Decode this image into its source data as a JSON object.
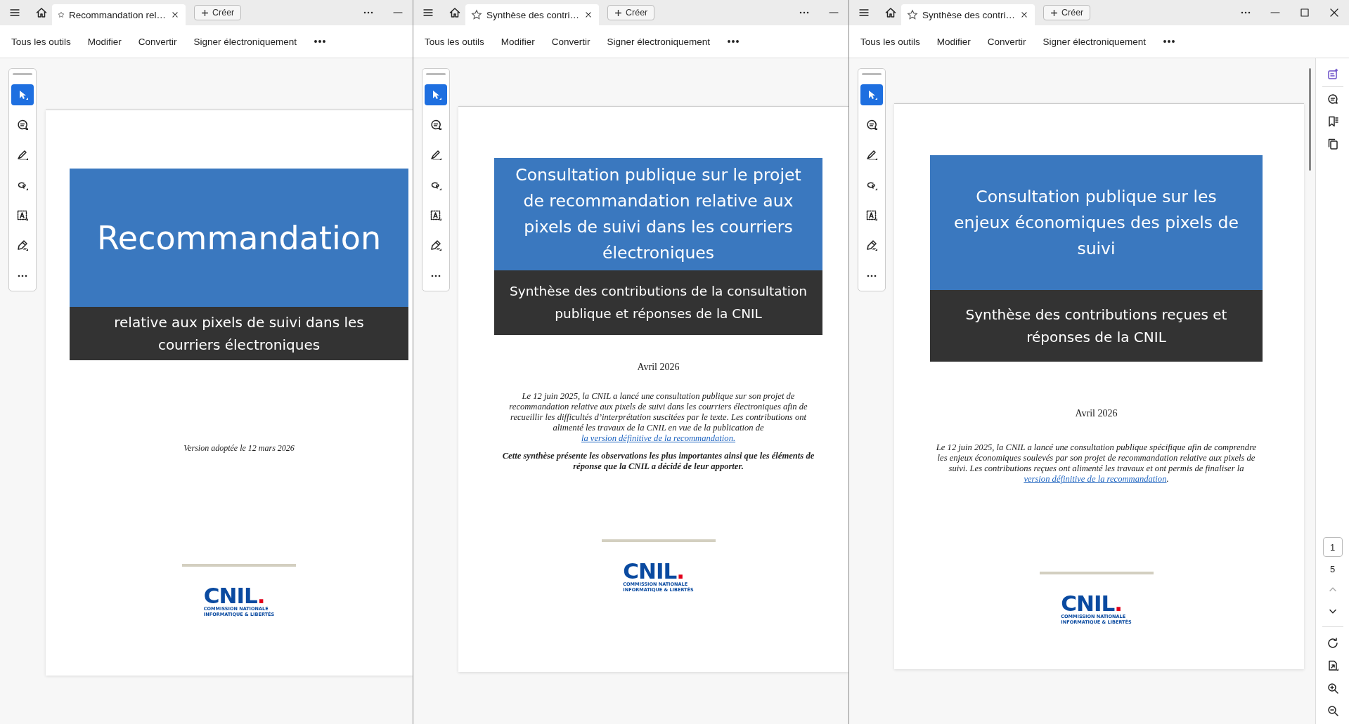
{
  "panes": [
    {
      "tab": {
        "title": "Recommandation rel…",
        "starred": false
      },
      "new_button": "Créer",
      "window_controls": [
        {
          "kind": "more"
        },
        {
          "kind": "minimize"
        }
      ],
      "menu": [
        "Tous les outils",
        "Modifier",
        "Convertir",
        "Signer électroniquement"
      ],
      "tools": [
        {
          "kind": "select",
          "selected": true
        },
        {
          "kind": "comment",
          "selected": false
        },
        {
          "kind": "highlight",
          "selected": false
        },
        {
          "kind": "draw",
          "selected": false
        },
        {
          "kind": "text",
          "selected": false
        },
        {
          "kind": "sign",
          "selected": false
        },
        {
          "kind": "more",
          "selected": false
        }
      ],
      "document": {
        "kind": "recommendation",
        "title": "Recommandation",
        "subtitle": "relative aux pixels de suivi dans les courriers électroniques",
        "version": "Version adoptée le 12 mars 2026",
        "logo": {
          "name": "CNIL",
          "dot": ".",
          "line_1": "COMMISSION NATIONALE",
          "line_2": "INFORMATIQUE & LIBERTÉS"
        }
      }
    },
    {
      "tab": {
        "title": "Synthèse des contri…",
        "starred": false
      },
      "new_button": "Créer",
      "window_controls": [
        {
          "kind": "more"
        },
        {
          "kind": "minimize"
        }
      ],
      "menu": [
        "Tous les outils",
        "Modifier",
        "Convertir",
        "Signer électroniquement"
      ],
      "tools": [
        {
          "kind": "select",
          "selected": true
        },
        {
          "kind": "comment",
          "selected": false
        },
        {
          "kind": "highlight",
          "selected": false
        },
        {
          "kind": "draw",
          "selected": false
        },
        {
          "kind": "text",
          "selected": false
        },
        {
          "kind": "sign",
          "selected": false
        },
        {
          "kind": "more",
          "selected": false
        }
      ],
      "document": {
        "kind": "synthesis",
        "title": "Consultation publique sur le projet de recommandation relative aux pixels de suivi dans les courriers électroniques",
        "subtitle": "Synthèse des contributions de la consultation publique et réponses de la CNIL",
        "date": "Avril 2026",
        "paragraphs": [
          {
            "text": "Le 12 juin 2025, la CNIL a lancé une consultation publique sur son projet de recommandation relative aux pixels de suivi dans les courriers électroniques afin de recueillir les difficultés d’interprétation suscitées par le texte. Les contributions ont alimenté les travaux de la CNIL en vue de la publication de ",
            "link": "la version définitive de la recommandation.",
            "bold": false
          },
          {
            "text": "Cette synthèse présente les observations les plus importantes ainsi que les éléments de réponse que la CNIL a décidé de leur apporter.",
            "bold": true
          }
        ],
        "logo": {
          "name": "CNIL",
          "dot": ".",
          "line_1": "COMMISSION NATIONALE",
          "line_2": "INFORMATIQUE & LIBERTÉS"
        }
      }
    },
    {
      "tab": {
        "title": "Synthèse des contri…",
        "starred": false
      },
      "new_button": "Créer",
      "window_controls": [
        {
          "kind": "more"
        },
        {
          "kind": "minimize"
        },
        {
          "kind": "maximize"
        },
        {
          "kind": "close"
        }
      ],
      "menu": [
        "Tous les outils",
        "Modifier",
        "Convertir",
        "Signer électroniquement"
      ],
      "tools": [
        {
          "kind": "select",
          "selected": true
        },
        {
          "kind": "comment",
          "selected": false
        },
        {
          "kind": "highlight",
          "selected": false
        },
        {
          "kind": "draw",
          "selected": false
        },
        {
          "kind": "text",
          "selected": false
        },
        {
          "kind": "sign",
          "selected": false
        },
        {
          "kind": "more",
          "selected": false
        }
      ],
      "document": {
        "kind": "synthesis",
        "title": "Consultation publique sur les enjeux économiques des pixels de suivi",
        "subtitle": "Synthèse des contributions reçues et réponses de la CNIL",
        "date": "Avril 2026",
        "paragraphs": [
          {
            "text": "Le 12 juin 2025, la CNIL a lancé une consultation publique spécifique afin de comprendre les enjeux économiques soulevés par son projet de recommandation relative aux pixels de suivi. Les contributions reçues ont alimenté les travaux et ont permis de finaliser la ",
            "link": "version définitive de la recommandation",
            "after": ".",
            "bold": false
          }
        ],
        "logo": {
          "name": "CNIL",
          "dot": ".",
          "line_1": "COMMISSION NATIONALE",
          "line_2": "INFORMATIQUE & LIBERTÉS"
        }
      },
      "sidebar": {
        "tools": [
          {
            "kind": "assistant"
          },
          {
            "kind": "comment"
          },
          {
            "kind": "bookmarks"
          },
          {
            "kind": "pages"
          }
        ],
        "page": "1",
        "total": "5",
        "previous_disabled": true,
        "actions": [
          {
            "kind": "rotate"
          },
          {
            "kind": "extract"
          },
          {
            "kind": "zoom-in"
          },
          {
            "kind": "zoom-out"
          }
        ]
      }
    }
  ]
}
